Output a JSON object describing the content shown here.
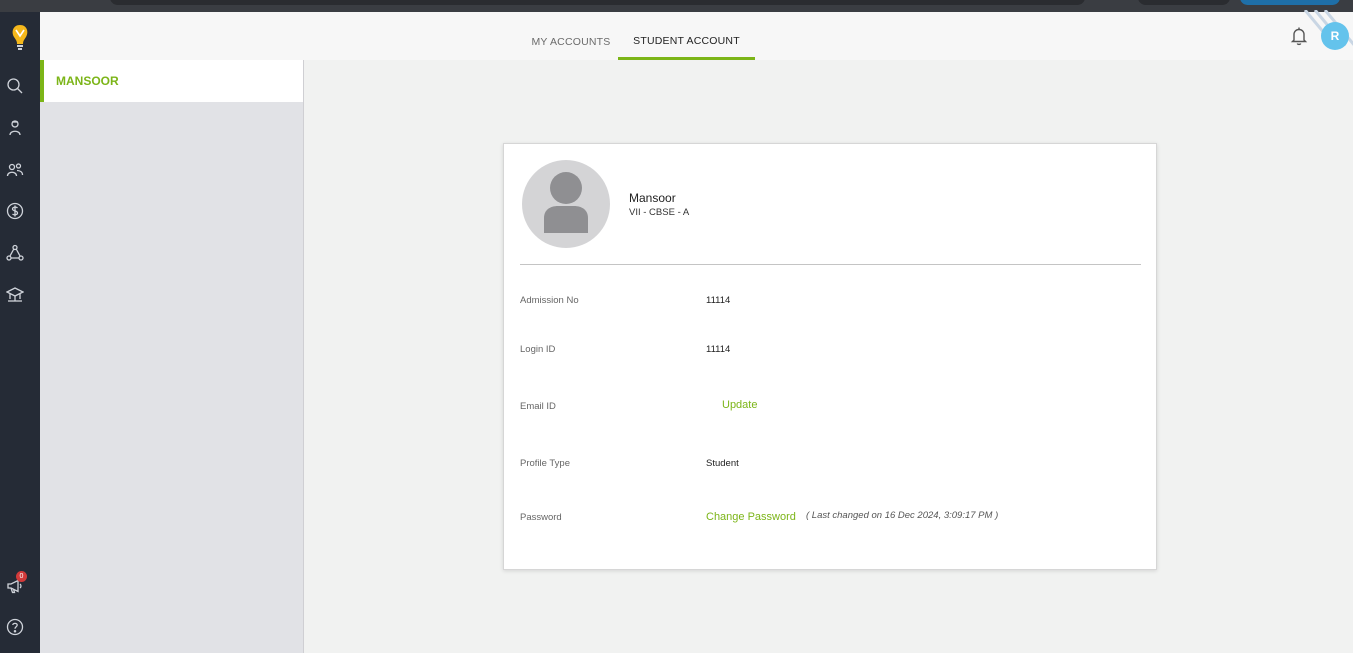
{
  "header": {
    "tabs": [
      {
        "label": "MY ACCOUNTS"
      },
      {
        "label": "STUDENT ACCOUNT"
      }
    ],
    "user_initial": "R"
  },
  "sidebar": {
    "badge_count": "0",
    "icons": [
      "logo-icon",
      "search-icon",
      "student-icon",
      "people-icon",
      "dollar-icon",
      "network-icon",
      "academics-icon",
      "announcement-icon",
      "help-icon"
    ]
  },
  "students": [
    {
      "name": "MANSOOR"
    }
  ],
  "profile": {
    "name": "Mansoor",
    "class": "VII - CBSE - A",
    "fields": {
      "admission_label": "Admission No",
      "admission_value": "11114",
      "login_label": "Login ID",
      "login_value": "11114",
      "email_label": "Email ID",
      "email_action": "Update",
      "profile_type_label": "Profile Type",
      "profile_type_value": "Student",
      "password_label": "Password",
      "password_action": "Change Password",
      "password_note": "( Last changed on 16 Dec 2024, 3:09:17 PM )"
    }
  },
  "colors": {
    "accent": "#7cb518",
    "rail": "#252b36",
    "avatar": "#64c3ec",
    "badge": "#d23a3a"
  }
}
